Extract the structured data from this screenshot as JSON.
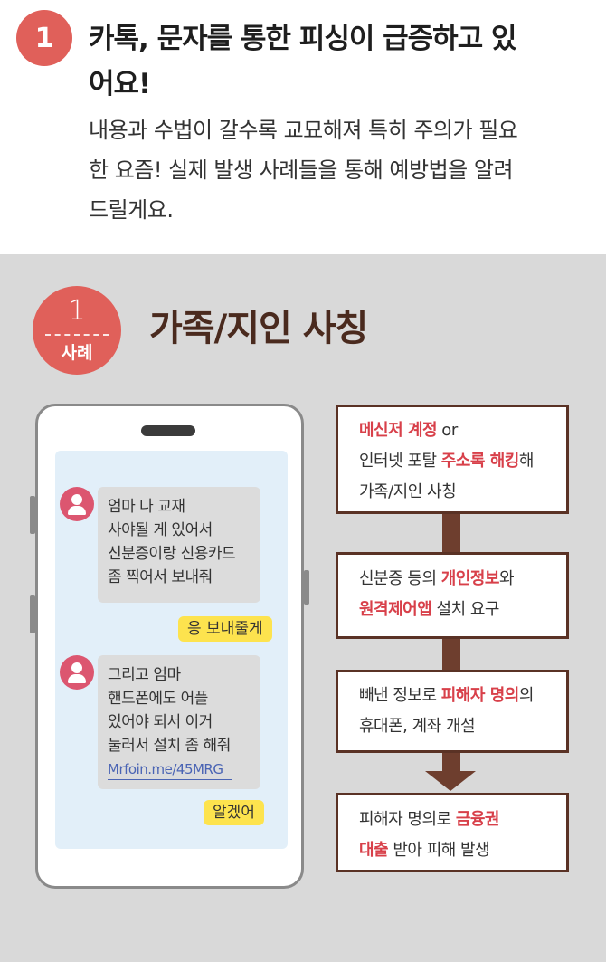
{
  "intro": {
    "number": "1",
    "headline_line1": "카톡, 문자를 통한 피싱이 급증하고 있",
    "headline_line2": "어요!",
    "body_line1": "내용과 수법이 갈수록 교묘해져 특히 주의가 필요",
    "body_line2": "한 요즘! 실제 발생 사례들을 통해 예방법을 알려",
    "body_line3": "드릴게요."
  },
  "case": {
    "number": "1",
    "label": "사례",
    "title": "가족/지인 사칭"
  },
  "chat": {
    "message1": [
      "엄마 나 교재",
      "사야될 게 있어서",
      "신분증이랑 신용카드",
      "좀 찍어서 보내줘"
    ],
    "reply1": "응 보내줄게",
    "message2": [
      "그리고 엄마",
      "핸드폰에도 어플",
      "있어야 되서 이거",
      "눌러서 설치 좀 해줘"
    ],
    "link": "Mrfoin.me/45MRG",
    "reply2": "알겠어"
  },
  "flow": {
    "step1": {
      "hl1": "메신저 계정",
      "t1": " or",
      "t2": "인터넷 포탈 ",
      "hl2": "주소록 해킹",
      "t3": "해",
      "t4": "가족/지인 사칭"
    },
    "step2": {
      "t1": "신분증 등의 ",
      "hl1": "개인정보",
      "t2": "와",
      "hl2": "원격제어앱",
      "t3": " 설치 요구"
    },
    "step3": {
      "t1": "빼낸 정보로 ",
      "hl1": "피해자 명의",
      "t2": "의",
      "t3": "휴대폰, 계좌 개설"
    },
    "step4": {
      "t1": "피해자 명의로 ",
      "hl1": "금융권",
      "hl2": "대출",
      "t2": " 받아 피해 발생"
    }
  },
  "colors": {
    "accent_red": "#e0605a",
    "highlight_red": "#d8404a",
    "brown": "#5a3225",
    "reply_yellow": "#fde34e",
    "chat_bg": "#e2eff9",
    "section_gray": "#d9d9d9"
  },
  "icons": [
    "user-avatar-icon",
    "down-arrow-icon"
  ]
}
